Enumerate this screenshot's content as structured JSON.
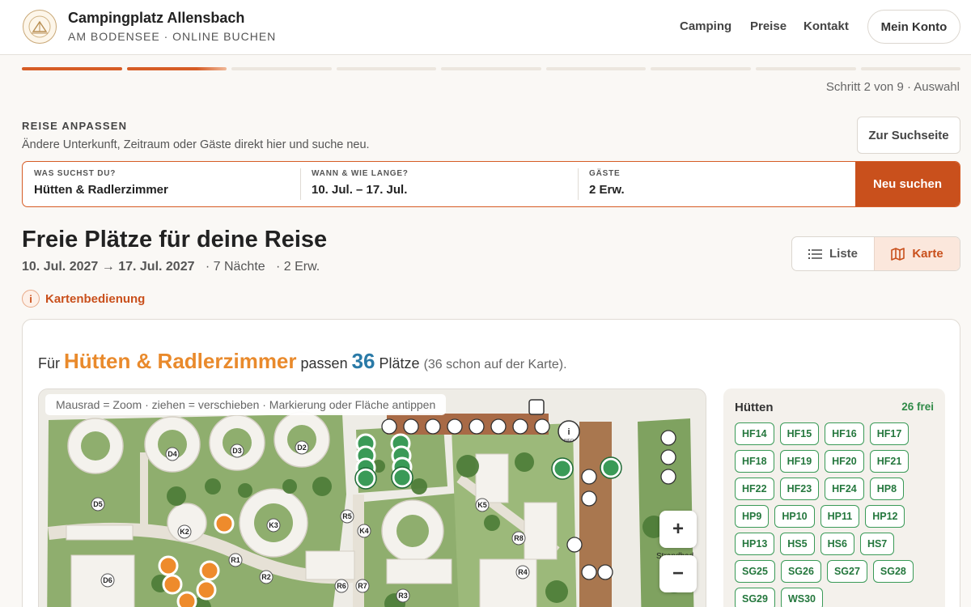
{
  "header": {
    "brand_name": "Campingplatz Allensbach",
    "brand_sub": "AM BODENSEE · ONLINE BUCHEN",
    "nav": [
      "Camping",
      "Preise",
      "Kontakt"
    ],
    "account": "Mein Konto"
  },
  "progress": {
    "current_step": 2,
    "total_steps": 9,
    "label": "Schritt 2 von 9 · Auswahl"
  },
  "adjust": {
    "title": "REISE ANPASSEN",
    "subtitle": "Ändere Unterkunft, Zeitraum oder Gäste direkt hier und suche neu.",
    "search_page_button": "Zur Suchseite"
  },
  "search": {
    "what_label": "WAS SUCHST DU?",
    "what_value": "Hütten & Radlerzimmer",
    "when_label": "WANN & WIE LANGE?",
    "when_value": "10. Jul. – 17. Jul.",
    "guests_label": "GÄSTE",
    "guests_value": "2 Erw.",
    "button": "Neu suchen"
  },
  "results": {
    "title": "Freie Plätze für deine Reise",
    "from": "10. Jul. 2027",
    "arrow": "→",
    "to": "17. Jul. 2027",
    "nights": "· 7 Nächte",
    "guests": "· 2 Erw.",
    "view_list": "Liste",
    "view_map": "Karte",
    "help": "Kartenbedienung"
  },
  "summary": {
    "prefix": "Für",
    "category": "Hütten & Radlerzimmer",
    "mid": "passen",
    "count": "36",
    "suffix": "Plätze",
    "note": "(36 schon auf der Karte)."
  },
  "map": {
    "hint": "Mausrad = Zoom · ziehen = verschieben · Markierung oder Fläche antippen",
    "zoom_in": "+",
    "zoom_out": "−",
    "labels": [
      "D5",
      "D4",
      "D3",
      "D2",
      "D6",
      "K2",
      "K3",
      "K4",
      "K5",
      "R1",
      "R2",
      "R3",
      "R4",
      "R5",
      "R6",
      "R7",
      "R8"
    ],
    "beach_label": "Strandbad",
    "info_label": "INFO"
  },
  "sidebar": {
    "title": "Hütten",
    "free": "26 frei",
    "sites": [
      "HF14",
      "HF15",
      "HF16",
      "HF17",
      "HF18",
      "HF19",
      "HF20",
      "HF21",
      "HF22",
      "HF23",
      "HF24",
      "HP8",
      "HP9",
      "HP10",
      "HP11",
      "HP12",
      "HP13",
      "HS5",
      "HS6",
      "HS7",
      "SG25",
      "SG26",
      "SG27",
      "SG28",
      "SG29",
      "WS30"
    ]
  },
  "colors": {
    "accent": "#c9501c",
    "highlight": "#e98a2c",
    "count": "#2a7aa7",
    "available": "#2f8a47",
    "grass": "#8fae6e"
  }
}
